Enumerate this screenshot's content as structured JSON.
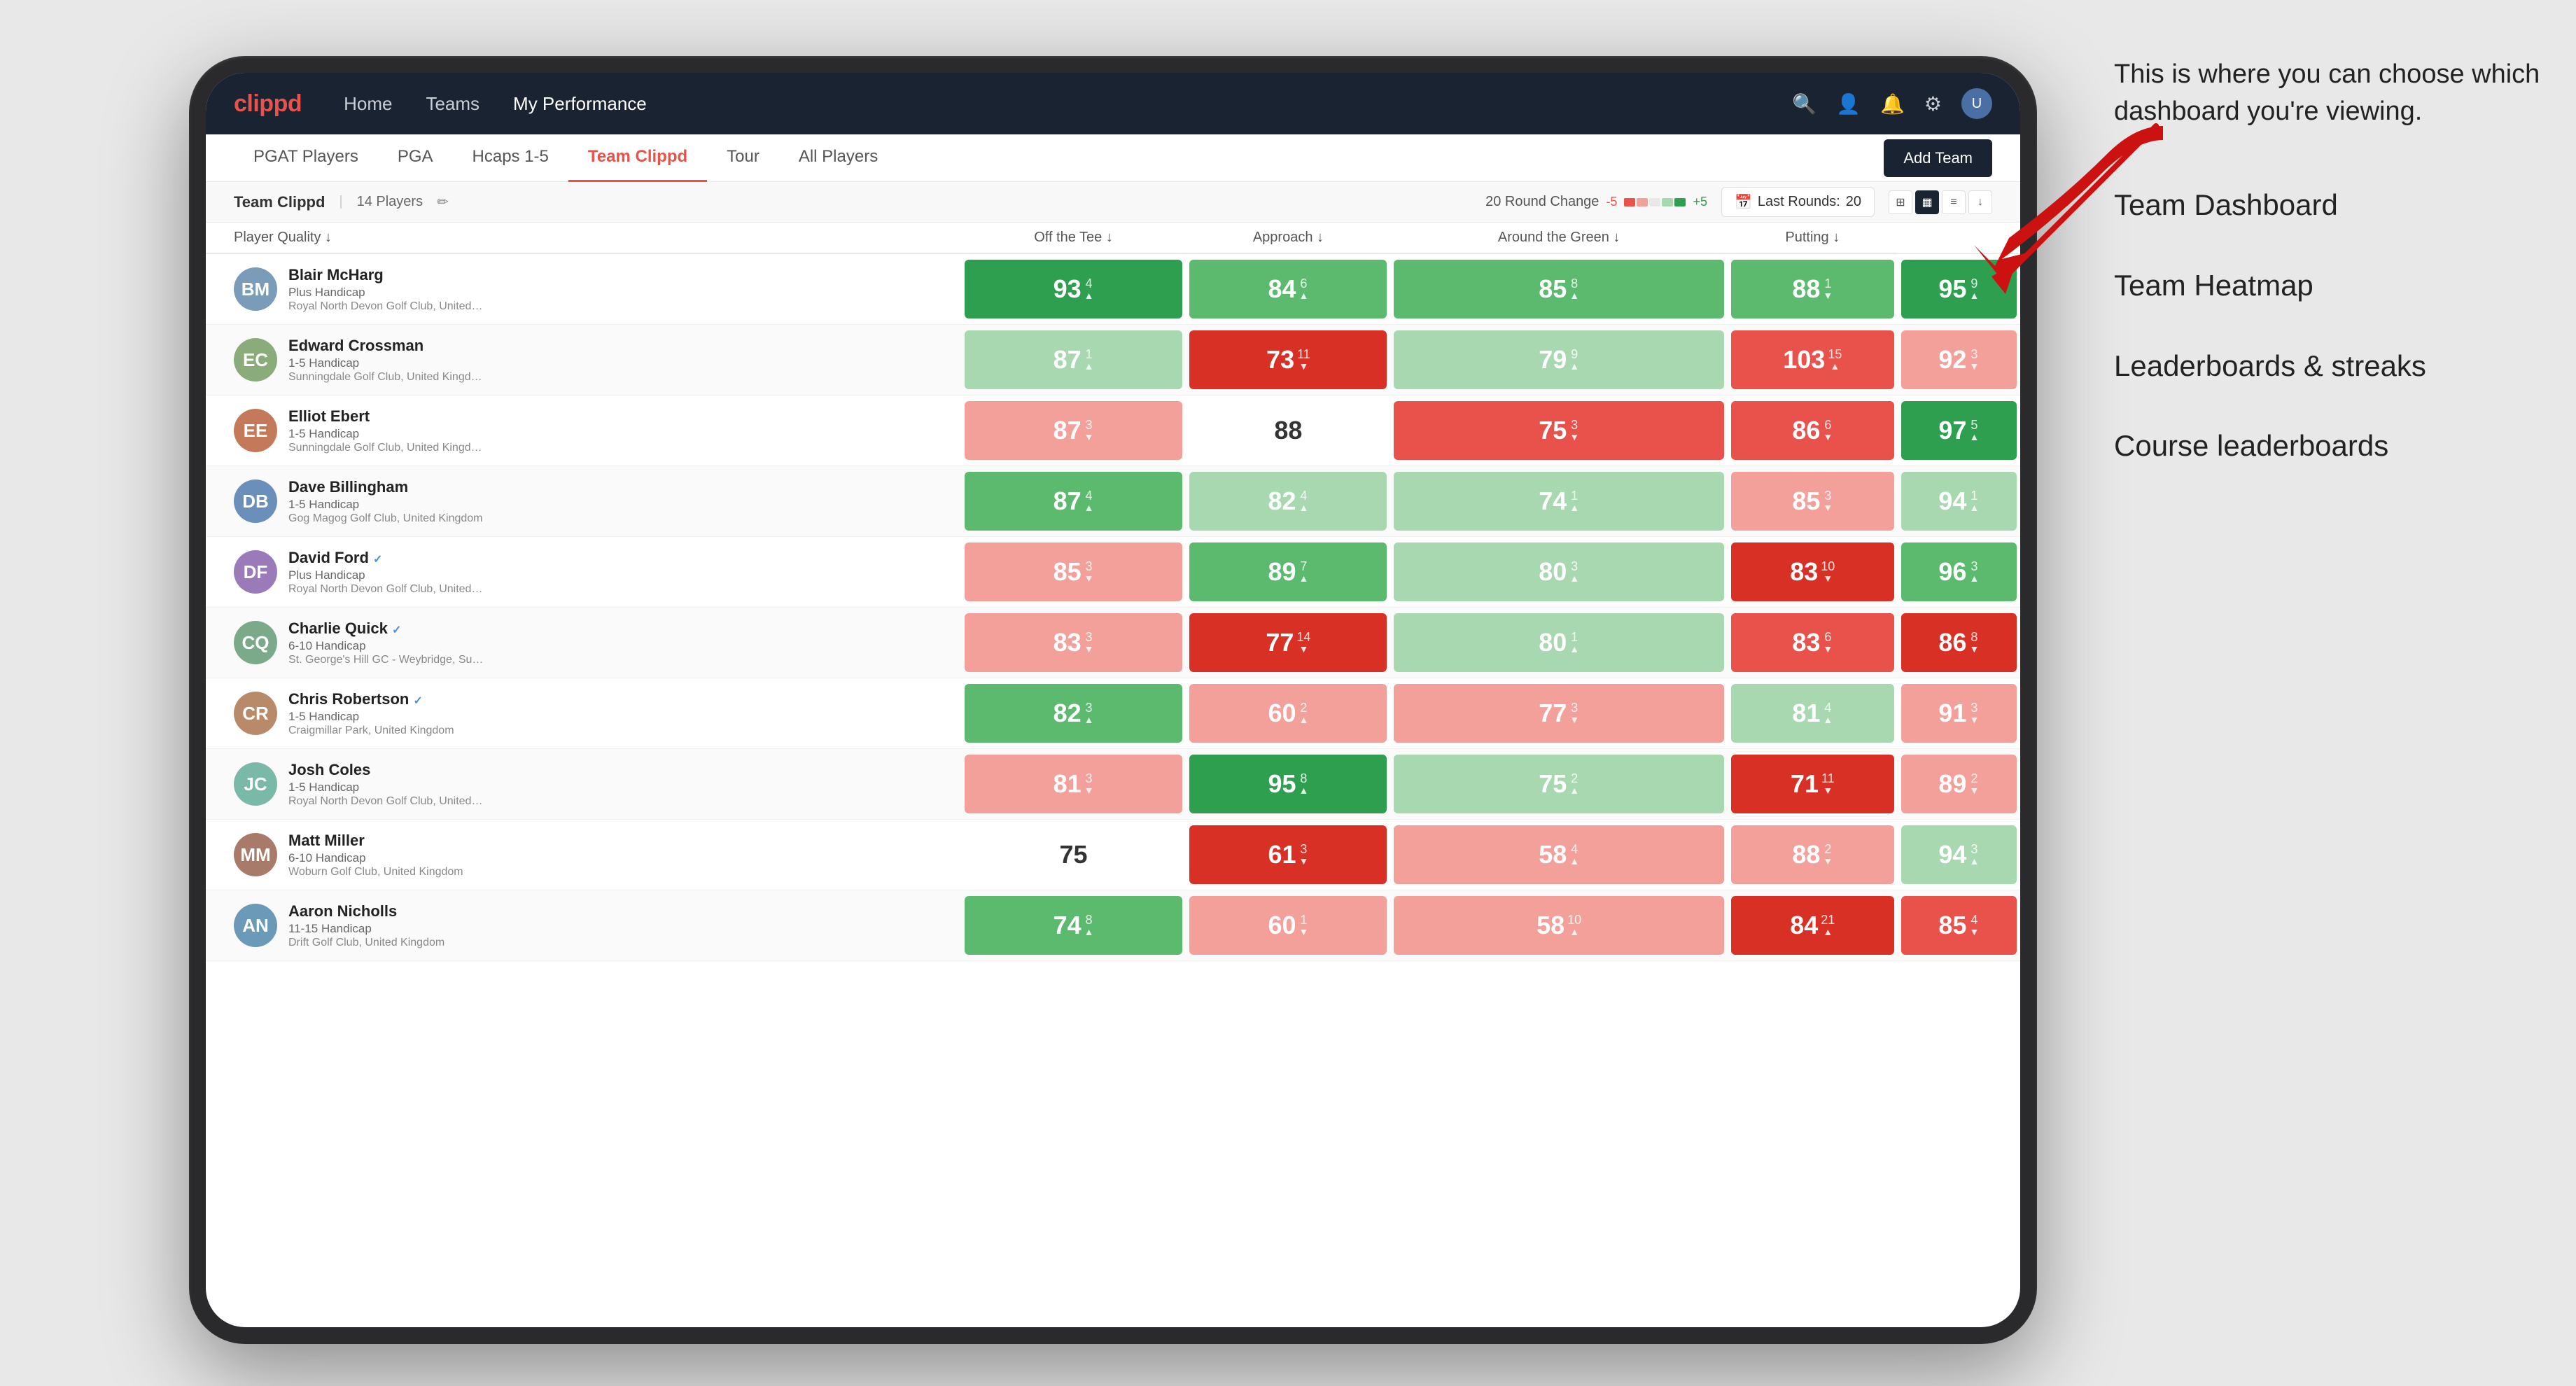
{
  "annotation": {
    "intro": "This is where you can choose which dashboard you're viewing.",
    "items": [
      "Team Dashboard",
      "Team Heatmap",
      "Leaderboards & streaks",
      "Course leaderboards"
    ]
  },
  "nav": {
    "logo": "clippd",
    "links": [
      "Home",
      "Teams",
      "My Performance"
    ],
    "active_link": "My Performance"
  },
  "subnav": {
    "links": [
      "PGAT Players",
      "PGA",
      "Hcaps 1-5",
      "Team Clippd",
      "Tour",
      "All Players"
    ],
    "active": "Team Clippd",
    "add_team_label": "Add Team"
  },
  "teambar": {
    "name": "Team Clippd",
    "separator": "|",
    "count": "14 Players",
    "round_change_label": "20 Round Change",
    "change_neg": "-5",
    "change_pos": "+5",
    "last_rounds_label": "Last Rounds:",
    "last_rounds_value": "20"
  },
  "table": {
    "columns": [
      "Player Quality ↓",
      "Off the Tee ↓",
      "Approach ↓",
      "Around the Green ↓",
      "Putting ↓"
    ],
    "column_keys": [
      "playerQuality",
      "offTee",
      "approach",
      "aroundGreen",
      "putting"
    ],
    "players": [
      {
        "name": "Blair McHarg",
        "handicap": "Plus Handicap",
        "club": "Royal North Devon Golf Club, United Kingdom",
        "avatar_color": "#7a9cb8",
        "initials": "BM",
        "playerQuality": {
          "value": 93,
          "change": 4,
          "dir": "up",
          "color": "green-strong"
        },
        "offTee": {
          "value": 84,
          "change": 6,
          "dir": "up",
          "color": "green-mid"
        },
        "approach": {
          "value": 85,
          "change": 8,
          "dir": "up",
          "color": "green-mid"
        },
        "aroundGreen": {
          "value": 88,
          "change": 1,
          "dir": "down",
          "color": "green-mid"
        },
        "putting": {
          "value": 95,
          "change": 9,
          "dir": "up",
          "color": "green-strong"
        }
      },
      {
        "name": "Edward Crossman",
        "handicap": "1-5 Handicap",
        "club": "Sunningdale Golf Club, United Kingdom",
        "avatar_color": "#8aab7a",
        "initials": "EC",
        "playerQuality": {
          "value": 87,
          "change": 1,
          "dir": "up",
          "color": "green-light"
        },
        "offTee": {
          "value": 73,
          "change": 11,
          "dir": "down",
          "color": "red-strong"
        },
        "approach": {
          "value": 79,
          "change": 9,
          "dir": "up",
          "color": "green-light"
        },
        "aroundGreen": {
          "value": 103,
          "change": 15,
          "dir": "up",
          "color": "red-mid"
        },
        "putting": {
          "value": 92,
          "change": 3,
          "dir": "down",
          "color": "red-light"
        }
      },
      {
        "name": "Elliot Ebert",
        "handicap": "1-5 Handicap",
        "club": "Sunningdale Golf Club, United Kingdom",
        "avatar_color": "#c47a5a",
        "initials": "EE",
        "playerQuality": {
          "value": 87,
          "change": 3,
          "dir": "down",
          "color": "red-light"
        },
        "offTee": {
          "value": 88,
          "change": 0,
          "dir": "none",
          "color": "white"
        },
        "approach": {
          "value": 75,
          "change": 3,
          "dir": "down",
          "color": "red-mid"
        },
        "aroundGreen": {
          "value": 86,
          "change": 6,
          "dir": "down",
          "color": "red-mid"
        },
        "putting": {
          "value": 97,
          "change": 5,
          "dir": "up",
          "color": "green-strong"
        }
      },
      {
        "name": "Dave Billingham",
        "handicap": "1-5 Handicap",
        "club": "Gog Magog Golf Club, United Kingdom",
        "avatar_color": "#6a8fba",
        "initials": "DB",
        "playerQuality": {
          "value": 87,
          "change": 4,
          "dir": "up",
          "color": "green-mid"
        },
        "offTee": {
          "value": 82,
          "change": 4,
          "dir": "up",
          "color": "green-light"
        },
        "approach": {
          "value": 74,
          "change": 1,
          "dir": "up",
          "color": "green-light"
        },
        "aroundGreen": {
          "value": 85,
          "change": 3,
          "dir": "down",
          "color": "red-light"
        },
        "putting": {
          "value": 94,
          "change": 1,
          "dir": "up",
          "color": "green-light"
        }
      },
      {
        "name": "David Ford",
        "handicap": "Plus Handicap",
        "club": "Royal North Devon Golf Club, United Kingdom",
        "avatar_color": "#9a7ab8",
        "initials": "DF",
        "verified": true,
        "playerQuality": {
          "value": 85,
          "change": 3,
          "dir": "down",
          "color": "red-light"
        },
        "offTee": {
          "value": 89,
          "change": 7,
          "dir": "up",
          "color": "green-mid"
        },
        "approach": {
          "value": 80,
          "change": 3,
          "dir": "up",
          "color": "green-light"
        },
        "aroundGreen": {
          "value": 83,
          "change": 10,
          "dir": "down",
          "color": "red-strong"
        },
        "putting": {
          "value": 96,
          "change": 3,
          "dir": "up",
          "color": "green-mid"
        }
      },
      {
        "name": "Charlie Quick",
        "handicap": "6-10 Handicap",
        "club": "St. George's Hill GC - Weybridge, Surrey, Uni...",
        "avatar_color": "#7aaa8a",
        "initials": "CQ",
        "verified": true,
        "playerQuality": {
          "value": 83,
          "change": 3,
          "dir": "down",
          "color": "red-light"
        },
        "offTee": {
          "value": 77,
          "change": 14,
          "dir": "down",
          "color": "red-strong"
        },
        "approach": {
          "value": 80,
          "change": 1,
          "dir": "up",
          "color": "green-light"
        },
        "aroundGreen": {
          "value": 83,
          "change": 6,
          "dir": "down",
          "color": "red-mid"
        },
        "putting": {
          "value": 86,
          "change": 8,
          "dir": "down",
          "color": "red-strong"
        }
      },
      {
        "name": "Chris Robertson",
        "handicap": "1-5 Handicap",
        "club": "Craigmillar Park, United Kingdom",
        "avatar_color": "#b88a6a",
        "initials": "CR",
        "verified": true,
        "playerQuality": {
          "value": 82,
          "change": 3,
          "dir": "up",
          "color": "green-mid"
        },
        "offTee": {
          "value": 60,
          "change": 2,
          "dir": "up",
          "color": "red-light"
        },
        "approach": {
          "value": 77,
          "change": 3,
          "dir": "down",
          "color": "red-light"
        },
        "aroundGreen": {
          "value": 81,
          "change": 4,
          "dir": "up",
          "color": "green-light"
        },
        "putting": {
          "value": 91,
          "change": 3,
          "dir": "down",
          "color": "red-light"
        }
      },
      {
        "name": "Josh Coles",
        "handicap": "1-5 Handicap",
        "club": "Royal North Devon Golf Club, United Kingdom",
        "avatar_color": "#7ab8a8",
        "initials": "JC",
        "playerQuality": {
          "value": 81,
          "change": 3,
          "dir": "down",
          "color": "red-light"
        },
        "offTee": {
          "value": 95,
          "change": 8,
          "dir": "up",
          "color": "green-strong"
        },
        "approach": {
          "value": 75,
          "change": 2,
          "dir": "up",
          "color": "green-light"
        },
        "aroundGreen": {
          "value": 71,
          "change": 11,
          "dir": "down",
          "color": "red-strong"
        },
        "putting": {
          "value": 89,
          "change": 2,
          "dir": "down",
          "color": "red-light"
        }
      },
      {
        "name": "Matt Miller",
        "handicap": "6-10 Handicap",
        "club": "Woburn Golf Club, United Kingdom",
        "avatar_color": "#a87a6a",
        "initials": "MM",
        "playerQuality": {
          "value": 75,
          "change": 0,
          "dir": "none",
          "color": "white"
        },
        "offTee": {
          "value": 61,
          "change": 3,
          "dir": "down",
          "color": "red-strong"
        },
        "approach": {
          "value": 58,
          "change": 4,
          "dir": "up",
          "color": "red-light"
        },
        "aroundGreen": {
          "value": 88,
          "change": 2,
          "dir": "down",
          "color": "red-light"
        },
        "putting": {
          "value": 94,
          "change": 3,
          "dir": "up",
          "color": "green-light"
        }
      },
      {
        "name": "Aaron Nicholls",
        "handicap": "11-15 Handicap",
        "club": "Drift Golf Club, United Kingdom",
        "avatar_color": "#6a9ab8",
        "initials": "AN",
        "playerQuality": {
          "value": 74,
          "change": 8,
          "dir": "up",
          "color": "green-mid"
        },
        "offTee": {
          "value": 60,
          "change": 1,
          "dir": "down",
          "color": "red-light"
        },
        "approach": {
          "value": 58,
          "change": 10,
          "dir": "up",
          "color": "red-light"
        },
        "aroundGreen": {
          "value": 84,
          "change": 21,
          "dir": "up",
          "color": "red-strong"
        },
        "putting": {
          "value": 85,
          "change": 4,
          "dir": "down",
          "color": "red-mid"
        }
      }
    ]
  },
  "colors": {
    "green_strong": "#2e9e4f",
    "green_mid": "#5cba6e",
    "green_light": "#a8d8b0",
    "red_strong": "#d93025",
    "red_mid": "#e8524a",
    "red_light": "#f4a09a",
    "white": "#ffffff",
    "nav_bg": "#1a2332",
    "logo": "#e8524a"
  }
}
